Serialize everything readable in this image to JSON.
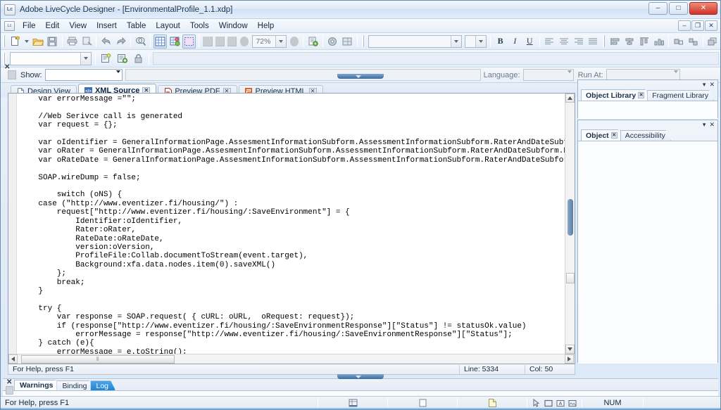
{
  "window": {
    "title": "Adobe LiveCycle Designer - [EnvironmentalProfile_1.1.xdp]",
    "app_icon": "adobe-livecycle-icon",
    "minimize": "–",
    "maximize": "□",
    "close": "✕",
    "mdi_minimize": "–",
    "mdi_restore": "❐",
    "mdi_close": "✕"
  },
  "menu": {
    "items": [
      {
        "label": "File"
      },
      {
        "label": "Edit"
      },
      {
        "label": "View"
      },
      {
        "label": "Insert"
      },
      {
        "label": "Table"
      },
      {
        "label": "Layout"
      },
      {
        "label": "Tools"
      },
      {
        "label": "Window"
      },
      {
        "label": "Help"
      }
    ]
  },
  "toolbar": {
    "zoom_value": "72%",
    "font_name": "",
    "font_size": "",
    "bold": "B",
    "italic": "I",
    "underline": "U"
  },
  "toolbar2": {
    "object_combo_value": ""
  },
  "script_bar": {
    "close": "✕",
    "show_label": "Show:",
    "show_value": "",
    "script_value": "",
    "language_label": "Language:",
    "language_value": "",
    "runat_label": "Run At:",
    "runat_value": ""
  },
  "tabs": [
    {
      "label": "Design View",
      "icon": "page-icon",
      "active": false,
      "closable": false
    },
    {
      "label": "XML Source",
      "icon": "xml-icon",
      "active": true,
      "closable": true,
      "close": "✕"
    },
    {
      "label": "Preview PDF",
      "icon": "pdf-icon",
      "active": false,
      "closable": true,
      "close": "✕"
    },
    {
      "label": "Preview HTML",
      "icon": "html-icon",
      "active": false,
      "closable": true,
      "close": "✕"
    }
  ],
  "editor": {
    "code": "    var errorMessage =\"\";\n\n    //Web Serivce call is generated\n    var request = {};\n\n    var oIdentifier = GeneralInformationPage.AssesmentInformationSubform.AssessmentInformationSubform.RaterAndDateSubform.Crypte\n    var oRater = GeneralInformationPage.AssesmentInformationSubform.AssessmentInformationSubform.RaterAndDateSubform.RaterTextFi\n    var oRateDate = GeneralInformationPage.AssesmentInformationSubform.AssessmentInformationSubform.RaterAndDateSubform.RatingDa\n\n    SOAP.wireDump = false;\n\n        switch (oNS) {\n    case (\"http://www.eventizer.fi/housing/\") :\n        request[\"http://www.eventizer.fi/housing/:SaveEnvironment\"] = {\n            Identifier:oIdentifier,\n            Rater:oRater,\n            RateDate:oRateDate,\n            version:oVersion,\n            ProfileFile:Collab.documentToStream(event.target),\n            Background:xfa.data.nodes.item(0).saveXML()\n        };\n        break;\n    }\n\n    try {\n        var response = SOAP.request( { cURL: oURL,  oRequest: request});\n        if (response[\"http://www.eventizer.fi/housing/:SaveEnvironmentResponse\"][\"Status\"] != statusOk.value)\n            errorMessage = response[\"http://www.eventizer.fi/housing/:SaveEnvironmentResponse\"][\"Status\"];\n    } catch (e){\n        errorMessage = e.toString();",
    "hscroll_grip": "‖"
  },
  "editor_status": {
    "help_text": "For Help, press F1",
    "line_label": "Line: 5334",
    "col_label": "Col: 50"
  },
  "right_panels": [
    {
      "name": "library-panel",
      "menu_glyph": "▾",
      "close_glyph": "✕",
      "tabs": [
        {
          "label": "Object Library",
          "active": true,
          "close": "✕"
        },
        {
          "label": "Fragment Library",
          "active": false
        }
      ]
    },
    {
      "name": "object-panel",
      "menu_glyph": "▾",
      "close_glyph": "✕",
      "tabs": [
        {
          "label": "Object",
          "active": true,
          "close": "✕"
        },
        {
          "label": "Accessibility",
          "active": false
        }
      ]
    }
  ],
  "bottom_panel": {
    "close": "✕",
    "tabs": [
      {
        "label": "Warnings",
        "state": "active"
      },
      {
        "label": "Binding",
        "state": "normal"
      },
      {
        "label": "Log",
        "state": "highlight"
      }
    ]
  },
  "statusbar": {
    "help_text": "For Help, press F1",
    "num_indicator": "NUM",
    "icons": [
      "tabular-view-icon",
      "page-outline-icon",
      "document-icon",
      "cursor-select-icon",
      "rectangle-icon",
      "text-box-icon",
      "image-placeholder-icon"
    ]
  }
}
